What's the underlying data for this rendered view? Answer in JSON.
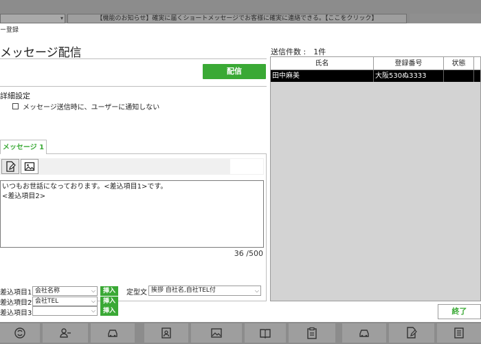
{
  "background": {
    "banner_text": "【機能のお知らせ】確実に届くショートメッセージでお客様に確実に連絡できる。【ここをクリック】"
  },
  "dialog": {
    "title": "ー登録",
    "main_title": "メッセージ配信",
    "send_button": "配信",
    "advanced_label": "詳細設定",
    "notify_checkbox": {
      "label": "メッセージ送信時に、ユーザーに通知しない",
      "checked": false
    },
    "tab_label": "メッセージ 1",
    "message_body": "いつもお世話になっております。<差込項目1>です。\n<差込項目2>",
    "char_counter": "36 /500",
    "insert_fields": [
      {
        "label": "差込項目1",
        "value": "会社名称",
        "button": "挿入"
      },
      {
        "label": "差込項目2",
        "value": "会社TEL",
        "button": "挿入"
      },
      {
        "label": "差込項目3",
        "value": "",
        "button": "挿入"
      }
    ],
    "template_label": "定型文",
    "template_value": "挨拶 自社名,自社TEL付",
    "recipient_count_label": "送信件数 :　1件",
    "table": {
      "headers": [
        "氏名",
        "登録番号",
        "状態"
      ],
      "rows": [
        [
          "田中麻美",
          "大阪530ぬ3333",
          ""
        ]
      ]
    },
    "end_button": "終了"
  },
  "colors": {
    "accent_green": "#3aa935",
    "selected_row": "#000000"
  },
  "bottom_icons": [
    "sync-icon",
    "users-icon",
    "car-icon",
    "contact-icon",
    "image-gallery-icon",
    "book-icon",
    "clipboard-icon",
    "car-icon",
    "document-edit-icon",
    "list-icon"
  ]
}
